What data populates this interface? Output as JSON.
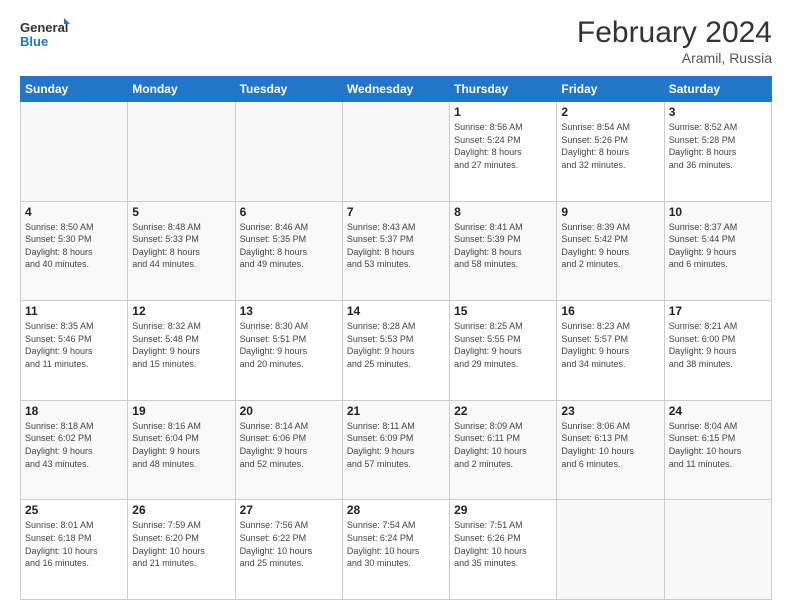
{
  "logo": {
    "line1": "General",
    "line2": "Blue"
  },
  "title": "February 2024",
  "location": "Aramil, Russia",
  "days_of_week": [
    "Sunday",
    "Monday",
    "Tuesday",
    "Wednesday",
    "Thursday",
    "Friday",
    "Saturday"
  ],
  "weeks": [
    [
      {
        "day": "",
        "info": ""
      },
      {
        "day": "",
        "info": ""
      },
      {
        "day": "",
        "info": ""
      },
      {
        "day": "",
        "info": ""
      },
      {
        "day": "1",
        "info": "Sunrise: 8:56 AM\nSunset: 5:24 PM\nDaylight: 8 hours\nand 27 minutes."
      },
      {
        "day": "2",
        "info": "Sunrise: 8:54 AM\nSunset: 5:26 PM\nDaylight: 8 hours\nand 32 minutes."
      },
      {
        "day": "3",
        "info": "Sunrise: 8:52 AM\nSunset: 5:28 PM\nDaylight: 8 hours\nand 36 minutes."
      }
    ],
    [
      {
        "day": "4",
        "info": "Sunrise: 8:50 AM\nSunset: 5:30 PM\nDaylight: 8 hours\nand 40 minutes."
      },
      {
        "day": "5",
        "info": "Sunrise: 8:48 AM\nSunset: 5:33 PM\nDaylight: 8 hours\nand 44 minutes."
      },
      {
        "day": "6",
        "info": "Sunrise: 8:46 AM\nSunset: 5:35 PM\nDaylight: 8 hours\nand 49 minutes."
      },
      {
        "day": "7",
        "info": "Sunrise: 8:43 AM\nSunset: 5:37 PM\nDaylight: 8 hours\nand 53 minutes."
      },
      {
        "day": "8",
        "info": "Sunrise: 8:41 AM\nSunset: 5:39 PM\nDaylight: 8 hours\nand 58 minutes."
      },
      {
        "day": "9",
        "info": "Sunrise: 8:39 AM\nSunset: 5:42 PM\nDaylight: 9 hours\nand 2 minutes."
      },
      {
        "day": "10",
        "info": "Sunrise: 8:37 AM\nSunset: 5:44 PM\nDaylight: 9 hours\nand 6 minutes."
      }
    ],
    [
      {
        "day": "11",
        "info": "Sunrise: 8:35 AM\nSunset: 5:46 PM\nDaylight: 9 hours\nand 11 minutes."
      },
      {
        "day": "12",
        "info": "Sunrise: 8:32 AM\nSunset: 5:48 PM\nDaylight: 9 hours\nand 15 minutes."
      },
      {
        "day": "13",
        "info": "Sunrise: 8:30 AM\nSunset: 5:51 PM\nDaylight: 9 hours\nand 20 minutes."
      },
      {
        "day": "14",
        "info": "Sunrise: 8:28 AM\nSunset: 5:53 PM\nDaylight: 9 hours\nand 25 minutes."
      },
      {
        "day": "15",
        "info": "Sunrise: 8:25 AM\nSunset: 5:55 PM\nDaylight: 9 hours\nand 29 minutes."
      },
      {
        "day": "16",
        "info": "Sunrise: 8:23 AM\nSunset: 5:57 PM\nDaylight: 9 hours\nand 34 minutes."
      },
      {
        "day": "17",
        "info": "Sunrise: 8:21 AM\nSunset: 6:00 PM\nDaylight: 9 hours\nand 38 minutes."
      }
    ],
    [
      {
        "day": "18",
        "info": "Sunrise: 8:18 AM\nSunset: 6:02 PM\nDaylight: 9 hours\nand 43 minutes."
      },
      {
        "day": "19",
        "info": "Sunrise: 8:16 AM\nSunset: 6:04 PM\nDaylight: 9 hours\nand 48 minutes."
      },
      {
        "day": "20",
        "info": "Sunrise: 8:14 AM\nSunset: 6:06 PM\nDaylight: 9 hours\nand 52 minutes."
      },
      {
        "day": "21",
        "info": "Sunrise: 8:11 AM\nSunset: 6:09 PM\nDaylight: 9 hours\nand 57 minutes."
      },
      {
        "day": "22",
        "info": "Sunrise: 8:09 AM\nSunset: 6:11 PM\nDaylight: 10 hours\nand 2 minutes."
      },
      {
        "day": "23",
        "info": "Sunrise: 8:06 AM\nSunset: 6:13 PM\nDaylight: 10 hours\nand 6 minutes."
      },
      {
        "day": "24",
        "info": "Sunrise: 8:04 AM\nSunset: 6:15 PM\nDaylight: 10 hours\nand 11 minutes."
      }
    ],
    [
      {
        "day": "25",
        "info": "Sunrise: 8:01 AM\nSunset: 6:18 PM\nDaylight: 10 hours\nand 16 minutes."
      },
      {
        "day": "26",
        "info": "Sunrise: 7:59 AM\nSunset: 6:20 PM\nDaylight: 10 hours\nand 21 minutes."
      },
      {
        "day": "27",
        "info": "Sunrise: 7:56 AM\nSunset: 6:22 PM\nDaylight: 10 hours\nand 25 minutes."
      },
      {
        "day": "28",
        "info": "Sunrise: 7:54 AM\nSunset: 6:24 PM\nDaylight: 10 hours\nand 30 minutes."
      },
      {
        "day": "29",
        "info": "Sunrise: 7:51 AM\nSunset: 6:26 PM\nDaylight: 10 hours\nand 35 minutes."
      },
      {
        "day": "",
        "info": ""
      },
      {
        "day": "",
        "info": ""
      }
    ]
  ]
}
